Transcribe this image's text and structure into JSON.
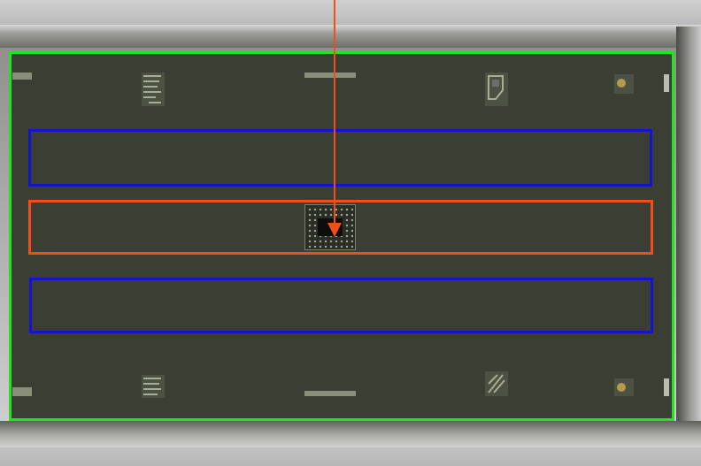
{
  "scene": {
    "colors": {
      "board": "#3b3e33",
      "outer_box": "#22e322",
      "lane_box_blue": "#1414cc",
      "lane_box_red": "#ee4f1b",
      "arrow": "#ee4f1b"
    },
    "boxes": [
      {
        "name": "outer-region",
        "color": "green"
      },
      {
        "name": "lane-top",
        "color": "blue"
      },
      {
        "name": "lane-middle",
        "color": "red"
      },
      {
        "name": "lane-bottom",
        "color": "blue"
      }
    ],
    "icons": [
      "circuit-chip-icon",
      "arrow-down-icon",
      "fiducial-mark-icon"
    ]
  }
}
